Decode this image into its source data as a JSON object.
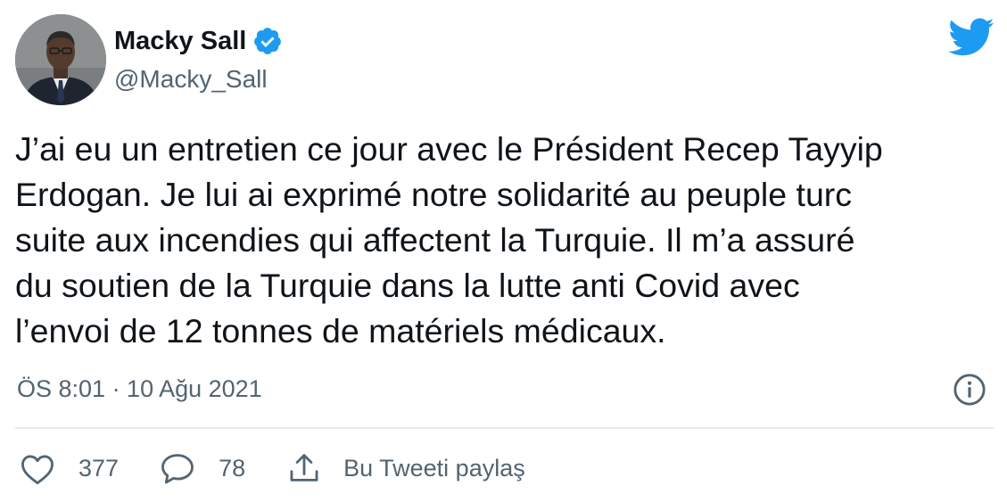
{
  "author": {
    "display_name": "Macky Sall",
    "handle": "@Macky_Sall",
    "verified": true
  },
  "tweet": {
    "text": "J’ai eu un entretien ce jour avec le Président Recep Tayyip\nErdogan. Je lui ai exprimé notre solidarité au peuple turc\nsuite aux incendies qui affectent la Turquie. Il m’a assuré\ndu soutien de la Turquie dans la lutte anti Covid avec\nl’envoi de 12 tonnes de matériels médicaux.",
    "timestamp": "ÖS 8:01 · 10 Ağu 2021"
  },
  "actions": {
    "like_count": "377",
    "reply_count": "78",
    "share_label": "Bu Tweeti paylaş"
  },
  "icons": {
    "brand": "twitter-bird-icon",
    "verified": "verified-badge-icon",
    "info": "info-icon",
    "like": "heart-icon",
    "reply": "comment-icon",
    "share": "share-icon"
  },
  "colors": {
    "brand_blue": "#1d9bf0",
    "text_primary": "#0f1419",
    "text_secondary": "#536471",
    "divider": "#e6ecf0"
  }
}
